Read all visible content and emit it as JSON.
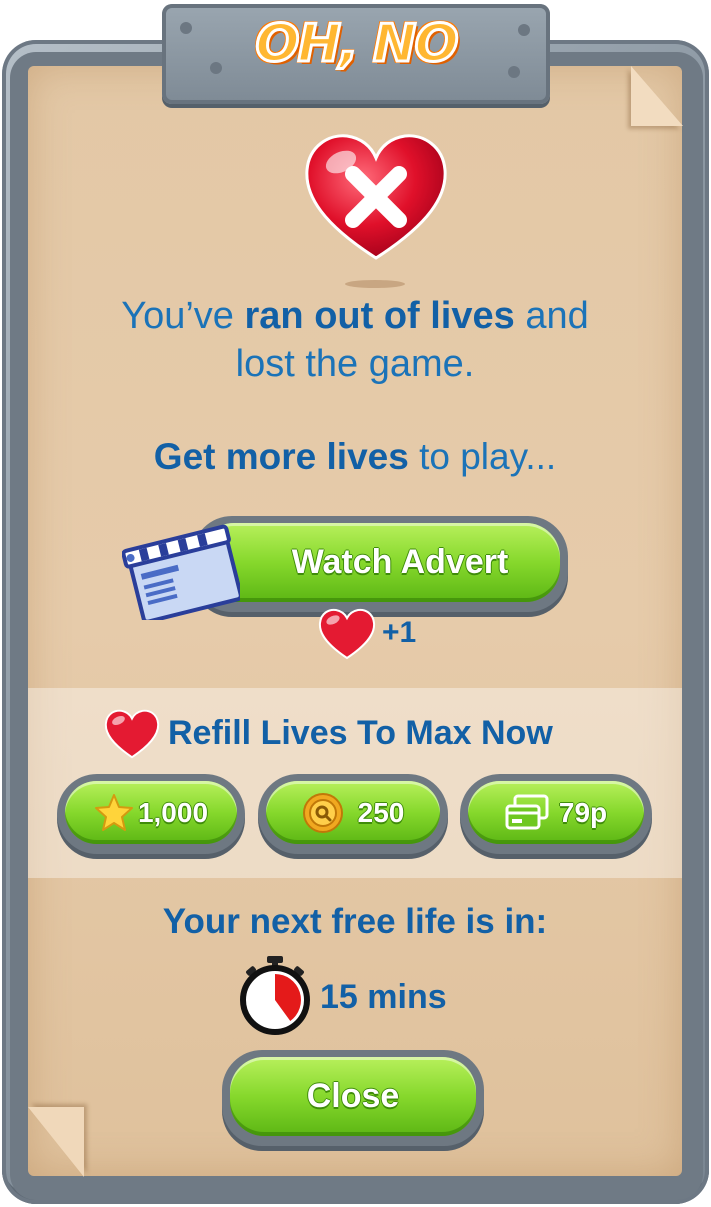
{
  "title": "OH, NO",
  "message": {
    "line1_prefix": "You’ve ",
    "line1_bold": "ran out of lives",
    "line1_suffix": " and",
    "line2": "lost the game."
  },
  "prompt": {
    "bold": "Get more lives",
    "rest": " to play..."
  },
  "watch_advert": {
    "label": "Watch Advert",
    "reward": "+1"
  },
  "refill": {
    "heading": "Refill Lives To Max Now",
    "options": [
      {
        "icon": "star-icon",
        "label": "1,000"
      },
      {
        "icon": "coin-icon",
        "label": "250"
      },
      {
        "icon": "card-icon",
        "label": "79p"
      }
    ]
  },
  "next_life": {
    "heading": "Your next free life is in:",
    "time": "15 mins",
    "timer_progress": 0.4
  },
  "close_label": "Close",
  "colors": {
    "text_blue": "#1b73b8",
    "button_green": "#86d82c",
    "title_orange": "#ffb732",
    "heart_red": "#e0102a"
  }
}
